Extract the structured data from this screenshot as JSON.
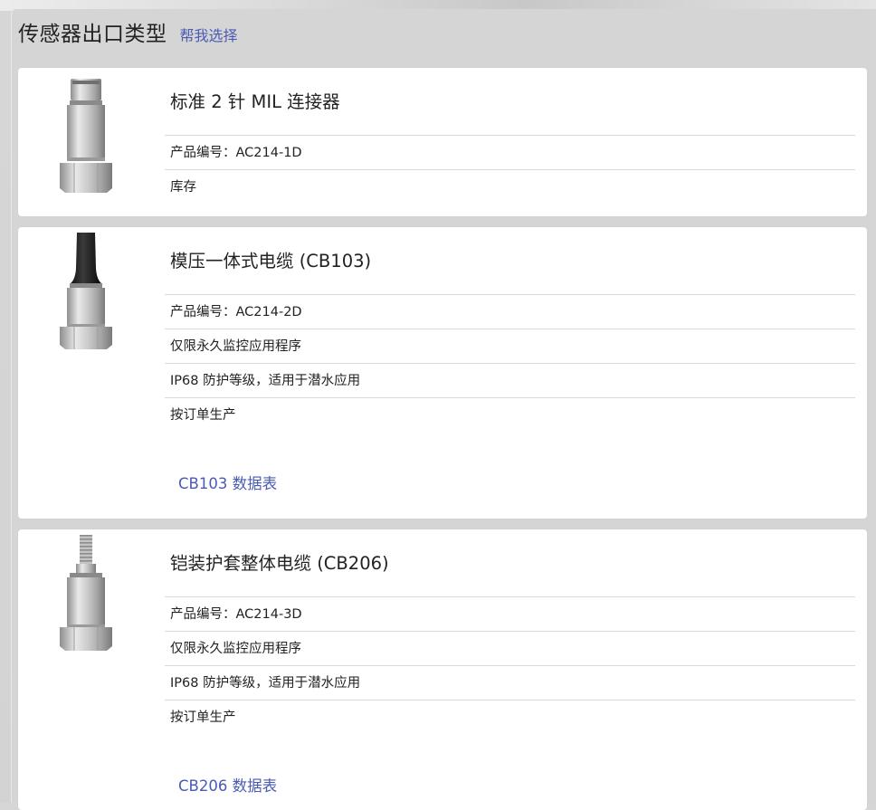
{
  "header": {
    "title": "传感器出口类型",
    "help_link": "帮我选择"
  },
  "options": [
    {
      "title": "标准 2 针 MIL 连接器",
      "rows": [
        "产品编号：AC214-1D",
        "库存"
      ],
      "datasheet": ""
    },
    {
      "title": "模压一体式电缆 (CB103)",
      "rows": [
        "产品编号：AC214-2D",
        "仅限永久监控应用程序",
        "IP68 防护等级，适用于潜水应用",
        "按订单生产"
      ],
      "datasheet": "CB103 数据表"
    },
    {
      "title": "铠装护套整体电缆 (CB206)",
      "rows": [
        "产品编号：AC214-3D",
        "仅限永久监控应用程序",
        "IP68 防护等级，适用于潜水应用",
        "按订单生产"
      ],
      "datasheet": "CB206 数据表"
    }
  ],
  "colors": {
    "link": "#4a5bb4",
    "background": "#d5d5d5",
    "card": "#ffffff",
    "divider": "#d9d9d9"
  }
}
